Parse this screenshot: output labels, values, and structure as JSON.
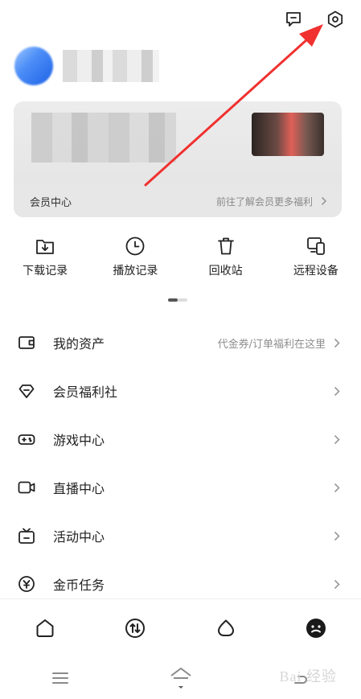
{
  "colors": {
    "annotation_arrow": "#f0312f",
    "text_primary": "#222222",
    "text_secondary": "#8e8e8e",
    "card_bg": "#e7e7e7"
  },
  "header": {
    "icons": [
      "message-icon",
      "settings-icon"
    ]
  },
  "vip_card": {
    "title": "会员中心",
    "link": "前往了解会员更多福利"
  },
  "quick_actions": [
    {
      "label": "下载记录",
      "icon": "download-icon"
    },
    {
      "label": "播放记录",
      "icon": "clock-icon"
    },
    {
      "label": "回收站",
      "icon": "trash-icon"
    },
    {
      "label": "远程设备",
      "icon": "devices-icon"
    }
  ],
  "menu": [
    {
      "label": "我的资产",
      "hint": "代金券/订单福利在这里",
      "icon": "wallet-icon"
    },
    {
      "label": "会员福利社",
      "hint": "",
      "icon": "diamond-icon"
    },
    {
      "label": "游戏中心",
      "hint": "",
      "icon": "gamepad-icon"
    },
    {
      "label": "直播中心",
      "hint": "",
      "icon": "video-camera-icon"
    },
    {
      "label": "活动中心",
      "hint": "",
      "icon": "tv-icon"
    },
    {
      "label": "金币任务",
      "hint": "",
      "icon": "coin-icon"
    }
  ],
  "tabbar": [
    {
      "icon": "home-icon"
    },
    {
      "icon": "transfer-icon"
    },
    {
      "icon": "cloud-icon"
    },
    {
      "icon": "profile-icon",
      "active": true
    }
  ],
  "watermark": "Bai 经验"
}
